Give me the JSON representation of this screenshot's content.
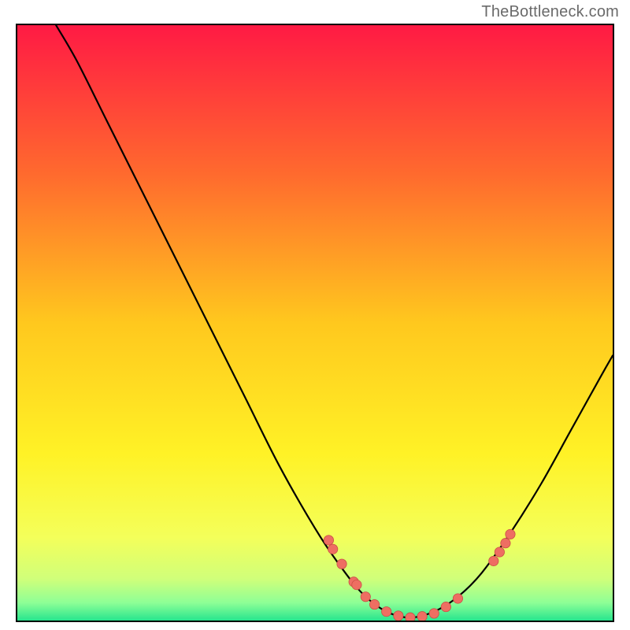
{
  "watermark": "TheBottleneck.com",
  "colors": {
    "gradient_stops": [
      {
        "offset": 0.0,
        "color": "#ff1a44"
      },
      {
        "offset": 0.25,
        "color": "#ff6a2e"
      },
      {
        "offset": 0.5,
        "color": "#ffc81e"
      },
      {
        "offset": 0.72,
        "color": "#fff226"
      },
      {
        "offset": 0.86,
        "color": "#f4ff5a"
      },
      {
        "offset": 0.93,
        "color": "#d0ff7a"
      },
      {
        "offset": 0.97,
        "color": "#8eff96"
      },
      {
        "offset": 1.0,
        "color": "#27e58e"
      }
    ],
    "curve": "#000000",
    "point_fill": "#ee6e62",
    "point_stroke": "#c94f45"
  },
  "chart_data": {
    "type": "line",
    "title": "",
    "xlabel": "",
    "ylabel": "",
    "xlim": [
      0,
      1
    ],
    "ylim": [
      0,
      1
    ],
    "note": "Axes are unlabeled; x/y values are fractional coordinates of the plot area (0,0 = top-left, 1,1 = bottom-right). Curve is a bottleneck V-shape with minimum near x≈0.65.",
    "curve": [
      {
        "x": 0.065,
        "y": 0.0
      },
      {
        "x": 0.1,
        "y": 0.06
      },
      {
        "x": 0.15,
        "y": 0.16
      },
      {
        "x": 0.22,
        "y": 0.3
      },
      {
        "x": 0.3,
        "y": 0.46
      },
      {
        "x": 0.38,
        "y": 0.62
      },
      {
        "x": 0.44,
        "y": 0.74
      },
      {
        "x": 0.5,
        "y": 0.845
      },
      {
        "x": 0.54,
        "y": 0.905
      },
      {
        "x": 0.58,
        "y": 0.955
      },
      {
        "x": 0.62,
        "y": 0.985
      },
      {
        "x": 0.66,
        "y": 0.995
      },
      {
        "x": 0.7,
        "y": 0.985
      },
      {
        "x": 0.74,
        "y": 0.96
      },
      {
        "x": 0.78,
        "y": 0.92
      },
      {
        "x": 0.83,
        "y": 0.85
      },
      {
        "x": 0.88,
        "y": 0.77
      },
      {
        "x": 0.93,
        "y": 0.68
      },
      {
        "x": 0.98,
        "y": 0.59
      },
      {
        "x": 1.0,
        "y": 0.555
      }
    ],
    "points": [
      {
        "x": 0.523,
        "y": 0.865
      },
      {
        "x": 0.53,
        "y": 0.88
      },
      {
        "x": 0.545,
        "y": 0.905
      },
      {
        "x": 0.565,
        "y": 0.935
      },
      {
        "x": 0.57,
        "y": 0.94
      },
      {
        "x": 0.585,
        "y": 0.96
      },
      {
        "x": 0.6,
        "y": 0.973
      },
      {
        "x": 0.62,
        "y": 0.985
      },
      {
        "x": 0.64,
        "y": 0.992
      },
      {
        "x": 0.66,
        "y": 0.995
      },
      {
        "x": 0.68,
        "y": 0.993
      },
      {
        "x": 0.7,
        "y": 0.988
      },
      {
        "x": 0.72,
        "y": 0.977
      },
      {
        "x": 0.74,
        "y": 0.963
      },
      {
        "x": 0.8,
        "y": 0.9
      },
      {
        "x": 0.81,
        "y": 0.885
      },
      {
        "x": 0.82,
        "y": 0.87
      },
      {
        "x": 0.828,
        "y": 0.855
      }
    ]
  }
}
